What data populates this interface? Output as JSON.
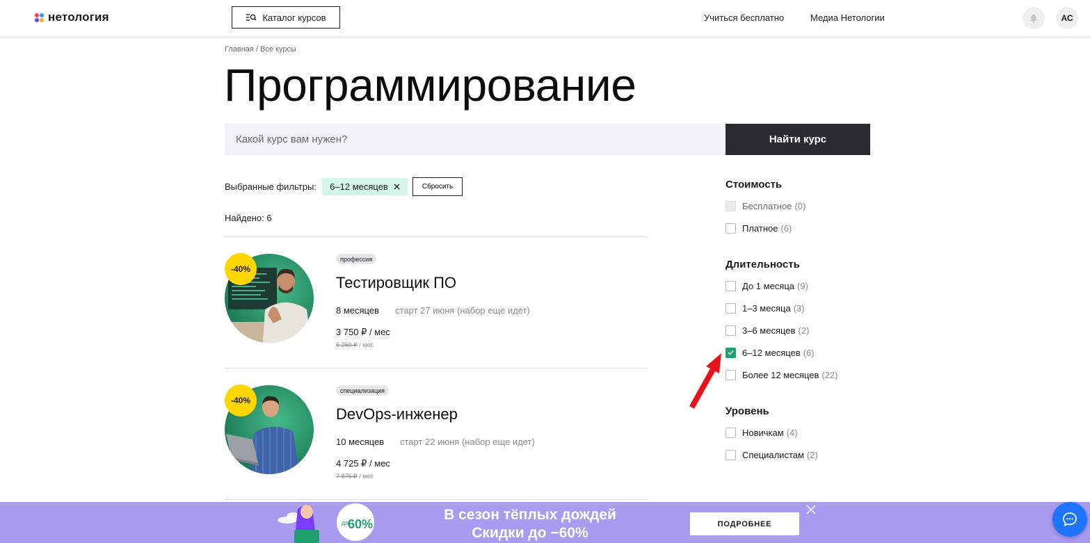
{
  "header": {
    "logo_text": "нетология",
    "catalog_label": "Каталог курсов",
    "nav": [
      "Учиться бесплатно",
      "Медиа Нетологии"
    ],
    "avatar_initials": "АС"
  },
  "breadcrumb": "Главная / Все курсы",
  "page_title": "Программирование",
  "search": {
    "placeholder": "Какой курс вам нужен?",
    "button_label": "Найти курс"
  },
  "filters": {
    "label": "Выбранные фильтры:",
    "chip": "6–12 месяцев",
    "reset_label": "Сбросить"
  },
  "found": "Найдено: 6",
  "courses": [
    {
      "discount": "-40%",
      "tag": "профессия",
      "title": "Тестировщик ПО",
      "duration": "8 месяцев",
      "start": "старт 27 июня (набор еще идет)",
      "price": "3 750 ₽ / мес",
      "old_price": "6 250 ₽",
      "old_price_unit": " / мес"
    },
    {
      "discount": "-40%",
      "tag": "специализация",
      "title": "DevOps-инженер",
      "duration": "10 месяцев",
      "start": "старт 22 июня (набор еще идет)",
      "price": "4 725 ₽ / мес",
      "old_price": "7 875 ₽",
      "old_price_unit": " / мес"
    }
  ],
  "sidebar": {
    "cost": {
      "heading": "Стоимость",
      "options": [
        {
          "label": "Бесплатное",
          "count": "(0)",
          "state": "disabled"
        },
        {
          "label": "Платное",
          "count": "(6)",
          "state": "unchecked"
        }
      ]
    },
    "duration": {
      "heading": "Длительность",
      "options": [
        {
          "label": "До 1 месяца",
          "count": "(9)",
          "state": "unchecked"
        },
        {
          "label": "1–3 месяца",
          "count": "(3)",
          "state": "unchecked"
        },
        {
          "label": "3–6 месяцев",
          "count": "(2)",
          "state": "unchecked"
        },
        {
          "label": "6–12 месяцев",
          "count": "(6)",
          "state": "checked"
        },
        {
          "label": "Более 12 месяцев",
          "count": "(22)",
          "state": "unchecked"
        }
      ]
    },
    "level": {
      "heading": "Уровень",
      "options": [
        {
          "label": "Новичкам",
          "count": "(4)",
          "state": "unchecked"
        },
        {
          "label": "Специалистам",
          "count": "(2)",
          "state": "unchecked"
        }
      ]
    }
  },
  "banner": {
    "line1": "В сезон тёплых дождей",
    "line2": "Скидки до −60%",
    "badge_prefix": "до",
    "badge_value": "60%",
    "button_label": "ПОДРОБНЕЕ"
  },
  "colors": {
    "accent_green": "#20a06d",
    "chip_bg": "#d4f5ea",
    "banner_bg": "#a89bf0",
    "discount_yellow": "#ffd600",
    "chat_blue": "#1e74ff",
    "annotation_arrow": "#e8121b"
  }
}
